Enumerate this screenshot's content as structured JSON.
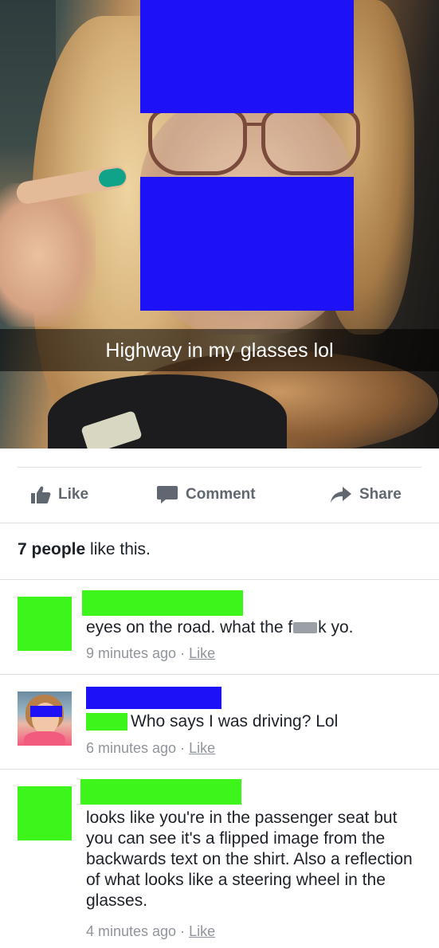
{
  "photo": {
    "caption": "Highway in my glasses lol"
  },
  "actions": {
    "like": "Like",
    "comment": "Comment",
    "share": "Share"
  },
  "likes_summary": {
    "count_text": "7 people",
    "suffix": " like this."
  },
  "comments": [
    {
      "text_before": "eyes on the road. what the f",
      "text_after": "k yo.",
      "time": "9 minutes ago",
      "separator": " · ",
      "like": "Like"
    },
    {
      "text": "Who says I was driving? Lol",
      "time": "6 minutes ago",
      "separator": " · ",
      "like": "Like"
    },
    {
      "text": "looks like you're in the passenger seat but you can see it's a flipped image from the backwards text on the shirt. Also a reflection of what looks like a steering wheel in the glasses.",
      "time": "4 minutes ago",
      "separator": " · ",
      "like": "Like"
    }
  ],
  "colors": {
    "redaction_blue": "#1c12f5",
    "redaction_green": "#3df51b",
    "meta_gray": "#90949c",
    "action_gray": "#606770"
  }
}
